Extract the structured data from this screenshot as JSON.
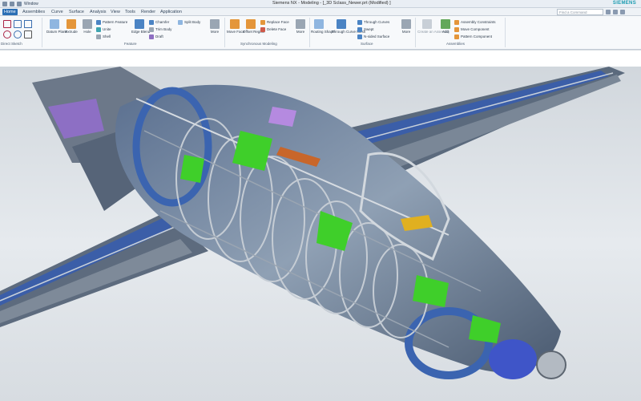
{
  "window": {
    "title": "Siemens NX - Modeling - [_3D Sclass_Newer.prt (Modified) ]",
    "brand": "SIEMENS",
    "quick_access_label": "Window"
  },
  "tabs": [
    {
      "label": "Home",
      "active": true
    },
    {
      "label": "Assemblies"
    },
    {
      "label": "Curve"
    },
    {
      "label": "Surface"
    },
    {
      "label": "Analysis"
    },
    {
      "label": "View"
    },
    {
      "label": "Tools"
    },
    {
      "label": "Render"
    },
    {
      "label": "Application"
    }
  ],
  "command_finder": {
    "placeholder": "Find a Command"
  },
  "ribbon": {
    "direct_sketch": {
      "group_label": "Direct Sketch"
    },
    "feature": {
      "datum_plane": "Datum Plane",
      "extrude": "Extrude",
      "hole": "Hole",
      "pattern_feature": "Pattern Feature",
      "unite": "Unite",
      "shell": "Shell",
      "edge_blend": "Edge Blend",
      "chamfer": "Chamfer",
      "trim_body": "Trim Body",
      "draft": "Draft",
      "split_body": "Split Body",
      "more": "More",
      "group_label": "Feature"
    },
    "synchronous": {
      "move_face": "Move Face",
      "offset_region": "Offset Region",
      "replace_face": "Replace Face",
      "delete_face": "Delete Face",
      "more": "More",
      "group_label": "Synchronous Modeling"
    },
    "surface": {
      "more": "More",
      "routing_shape": "Routing Shape",
      "through_curve_mesh": "Through Curve Mesh",
      "through_curves": "Through Curves",
      "swept": "Swept",
      "n_sided_surface": "N-sided Surface",
      "more2": "More",
      "group_label": "Surface"
    },
    "assemblies": {
      "create_assembly": "Create an Assembly",
      "add": "Add",
      "assembly_constraints": "Assembly Constraints",
      "move_component": "Move Component",
      "pattern_component": "Pattern Component",
      "group_label": "Assemblies"
    }
  },
  "colors": {
    "accent": "#2b6fb5",
    "brand": "#1a9bb0",
    "fuselage_blue": "#3b64b0",
    "structure_green": "#3fcf2a",
    "frame_gray": "#8c96a2"
  },
  "icons": {
    "qat": [
      "save-icon",
      "undo-icon",
      "redo-icon"
    ]
  }
}
